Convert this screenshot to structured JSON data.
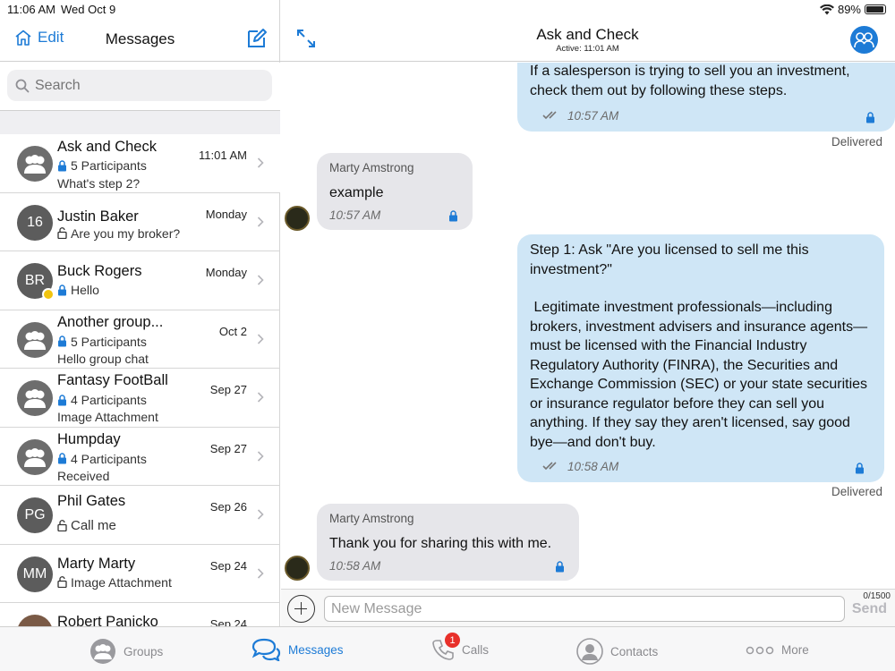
{
  "status_bar": {
    "time": "11:06 AM",
    "date": "Wed Oct 9",
    "battery": "89%"
  },
  "left_header": {
    "edit_label": "Edit",
    "title": "Messages"
  },
  "search": {
    "placeholder": "Search"
  },
  "conversations": [
    {
      "name": "Ask and Check",
      "time": "11:01 AM",
      "line1": "5 Participants",
      "line2": "What's step 2?",
      "avatar": "group",
      "locked": true
    },
    {
      "name": "Justin Baker",
      "time": "Monday",
      "line1": "Are you my broker?",
      "line2": "",
      "avatar": "16",
      "locked": false
    },
    {
      "name": "Buck Rogers",
      "time": "Monday",
      "line1": "Hello",
      "line2": "",
      "avatar": "BR",
      "locked": true
    },
    {
      "name": "Another group...",
      "time": "Oct 2",
      "line1": "5 Participants",
      "line2": "Hello group chat",
      "avatar": "group",
      "locked": true
    },
    {
      "name": "Fantasy FootBall",
      "time": "Sep 27",
      "line1": "4 Participants",
      "line2": "Image Attachment",
      "avatar": "group",
      "locked": true
    },
    {
      "name": "Humpday",
      "time": "Sep 27",
      "line1": "4 Participants",
      "line2": "Received",
      "avatar": "group",
      "locked": true
    },
    {
      "name": "Phil Gates",
      "time": "Sep 26",
      "line1": "Call me",
      "line2": "",
      "avatar": "PG",
      "locked": false
    },
    {
      "name": "Marty Marty",
      "time": "Sep 24",
      "line1": "Image Attachment",
      "line2": "",
      "avatar": "MM",
      "locked": false
    },
    {
      "name": "Robert Panicko",
      "time": "Sep 24",
      "line1": "",
      "line2": "",
      "avatar": "photo",
      "locked": false
    }
  ],
  "chat_header": {
    "title": "Ask and Check",
    "subtitle": "Active: 11:01 AM"
  },
  "messages": [
    {
      "direction": "out",
      "text": "If a salesperson is trying to sell you an investment, check them out by following these steps.",
      "time": "10:57 AM",
      "status": "Delivered"
    },
    {
      "direction": "in",
      "sender": "Marty Amstrong",
      "text": "example",
      "time": "10:57 AM"
    },
    {
      "direction": "out",
      "text_lines": [
        "Step 1: Ask \"Are you licensed to sell me this investment?\"",
        "",
        " Legitimate investment professionals—including brokers, investment advisers and insurance agents—must be licensed with the Financial Industry Regulatory Authority (FINRA), the Securities and Exchange Commission (SEC) or your state securities or insurance regulator before they can sell you anything. If they say they aren't licensed, say good bye—and don't buy."
      ],
      "time": "10:58 AM",
      "status": "Delivered"
    },
    {
      "direction": "in",
      "sender": "Marty Amstrong",
      "text": "Thank you for sharing this with me.",
      "time": "10:58 AM"
    }
  ],
  "composer": {
    "placeholder": "New Message",
    "counter": "0/1500",
    "send_label": "Send"
  },
  "tabs": [
    {
      "label": "Groups",
      "active": false
    },
    {
      "label": "Messages",
      "active": true
    },
    {
      "label": "Calls",
      "active": false,
      "badge": "1"
    },
    {
      "label": "Contacts",
      "active": false
    },
    {
      "label": "More",
      "active": false
    }
  ],
  "colors": {
    "accent": "#1d7bd6",
    "outgoing_bubble": "#cfe6f6",
    "incoming_bubble": "#e6e6ea",
    "badge": "#e8302a",
    "presence": "#f1c40f"
  }
}
